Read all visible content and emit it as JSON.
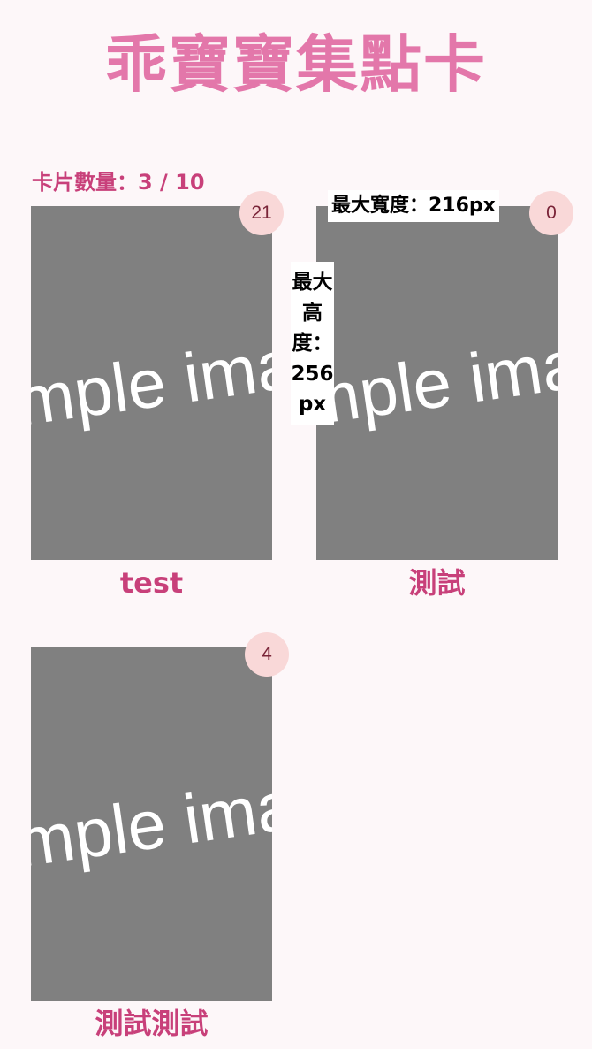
{
  "header": {
    "title": "乖寶寶集點卡"
  },
  "summary": {
    "card_count_label": "卡片數量：3 / 10"
  },
  "cards": [
    {
      "image_text": "Sample image",
      "badge": "21",
      "name": "test"
    },
    {
      "image_text": "Sample image",
      "badge": "0",
      "name": "測試"
    },
    {
      "image_text": "Sample image",
      "badge": "4",
      "name": "測試測試"
    }
  ],
  "overlays": {
    "max_width_label": "最大寬度：216px",
    "max_height_label": "最大高度：256px"
  },
  "colors": {
    "background": "#fdf7f9",
    "title": "#e377aa",
    "accent": "#c8407a",
    "badge_bg": "#f9d8d8",
    "badge_text": "#7a2438",
    "placeholder": "#808080"
  }
}
